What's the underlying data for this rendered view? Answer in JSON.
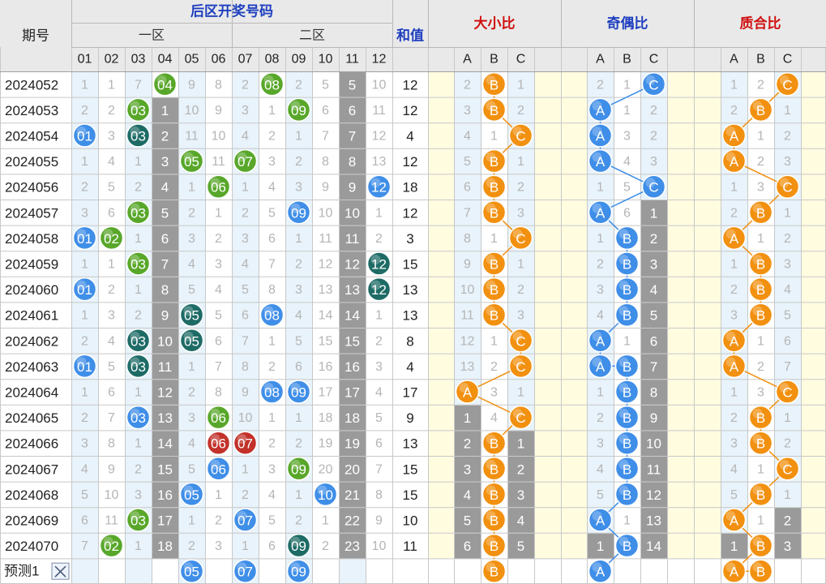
{
  "header": {
    "period_label": "期号",
    "back_zone_title": "后区开奖号码",
    "zone1_label": "一区",
    "zone2_label": "二区",
    "sum_label": "和值",
    "size_ratio_label": "大小比",
    "odd_even_label": "奇偶比",
    "prime_label": "质合比"
  },
  "num_headers": [
    "01",
    "02",
    "03",
    "04",
    "05",
    "06",
    "07",
    "08",
    "09",
    "10",
    "11",
    "12"
  ],
  "ratio_headers": [
    "A",
    "B",
    "C"
  ],
  "colors": {
    "header_bg": "#e9e9e9",
    "title_blue": "#1f3fbf",
    "title_red": "#d01010",
    "stripe_blue": "#e8f3fb",
    "stripe_white": "#ffffff",
    "yellow_bg": "#fffce0",
    "miss_gray": "#9a9a9a",
    "ball_green": "#58a72a",
    "ball_blue": "#3f8ee8",
    "ball_teal": "#1e6b66",
    "ball_red": "#c2322a",
    "ball_orange": "#f2900f",
    "line_blue": "#3f8ee8",
    "line_orange": "#f2900f"
  },
  "rows": [
    {
      "period": "2024052",
      "cells": [
        "1",
        "1",
        "7",
        "04",
        "9",
        "8",
        "2",
        "08",
        "2",
        "5",
        "5",
        "10"
      ],
      "ball": [
        "",
        "",
        "",
        "green",
        "",
        "",
        "",
        "green",
        "",
        "",
        "",
        ""
      ],
      "sum": "12",
      "size": [
        "2",
        "B",
        "1"
      ],
      "parity": [
        "2",
        "1",
        "C"
      ],
      "prime": [
        "1",
        "2",
        "C"
      ]
    },
    {
      "period": "2024053",
      "cells": [
        "2",
        "2",
        "03",
        "1",
        "10",
        "9",
        "3",
        "1",
        "09",
        "6",
        "6",
        "11"
      ],
      "ball": [
        "",
        "",
        "green",
        "",
        "",
        "",
        "",
        "",
        "green",
        "",
        "",
        ""
      ],
      "sum": "12",
      "size": [
        "3",
        "B",
        "2"
      ],
      "parity": [
        "A",
        "1",
        "2"
      ],
      "prime": [
        "2",
        "B",
        "1"
      ]
    },
    {
      "period": "2024054",
      "cells": [
        "01",
        "3",
        "03",
        "2",
        "11",
        "10",
        "4",
        "2",
        "1",
        "7",
        "7",
        "12"
      ],
      "ball": [
        "blue",
        "",
        "teal",
        "",
        "",
        "",
        "",
        "",
        "",
        "",
        "",
        ""
      ],
      "sum": "4",
      "size": [
        "4",
        "1",
        "C"
      ],
      "parity": [
        "A",
        "3",
        "2"
      ],
      "prime": [
        "A",
        "1",
        "2"
      ]
    },
    {
      "period": "2024055",
      "cells": [
        "1",
        "4",
        "1",
        "3",
        "05",
        "11",
        "07",
        "3",
        "2",
        "8",
        "8",
        "13"
      ],
      "ball": [
        "",
        "",
        "",
        "",
        "green",
        "",
        "green",
        "",
        "",
        "",
        "",
        ""
      ],
      "sum": "12",
      "size": [
        "5",
        "B",
        "1"
      ],
      "parity": [
        "A",
        "4",
        "3"
      ],
      "prime": [
        "A",
        "2",
        "3"
      ]
    },
    {
      "period": "2024056",
      "cells": [
        "2",
        "5",
        "2",
        "4",
        "1",
        "06",
        "1",
        "4",
        "3",
        "9",
        "9",
        "12"
      ],
      "ball": [
        "",
        "",
        "",
        "",
        "",
        "green",
        "",
        "",
        "",
        "",
        "",
        "blue"
      ],
      "sum": "18",
      "size": [
        "6",
        "B",
        "2"
      ],
      "parity": [
        "1",
        "5",
        "C"
      ],
      "prime": [
        "1",
        "3",
        "C"
      ]
    },
    {
      "period": "2024057",
      "cells": [
        "3",
        "6",
        "03",
        "5",
        "2",
        "1",
        "2",
        "5",
        "09",
        "10",
        "10",
        "1"
      ],
      "ball": [
        "",
        "",
        "green",
        "",
        "",
        "",
        "",
        "",
        "blue",
        "",
        "",
        ""
      ],
      "sum": "12",
      "size": [
        "7",
        "B",
        "3"
      ],
      "parity": [
        "A",
        "6",
        "1"
      ],
      "prime": [
        "2",
        "B",
        "1"
      ]
    },
    {
      "period": "2024058",
      "cells": [
        "01",
        "02",
        "1",
        "6",
        "3",
        "2",
        "3",
        "6",
        "1",
        "11",
        "11",
        "2"
      ],
      "ball": [
        "blue",
        "green",
        "",
        "",
        "",
        "",
        "",
        "",
        "",
        "",
        "",
        ""
      ],
      "sum": "3",
      "size": [
        "8",
        "1",
        "C"
      ],
      "parity": [
        "1",
        "B",
        "2"
      ],
      "prime": [
        "A",
        "1",
        "2"
      ]
    },
    {
      "period": "2024059",
      "cells": [
        "1",
        "1",
        "03",
        "7",
        "4",
        "3",
        "4",
        "7",
        "2",
        "12",
        "12",
        "12"
      ],
      "ball": [
        "",
        "",
        "green",
        "",
        "",
        "",
        "",
        "",
        "",
        "",
        "",
        "teal"
      ],
      "sum": "15",
      "size": [
        "9",
        "B",
        "1"
      ],
      "parity": [
        "2",
        "B",
        "3"
      ],
      "prime": [
        "1",
        "B",
        "3"
      ]
    },
    {
      "period": "2024060",
      "cells": [
        "01",
        "2",
        "1",
        "8",
        "5",
        "4",
        "5",
        "8",
        "3",
        "13",
        "13",
        "12"
      ],
      "ball": [
        "blue",
        "",
        "",
        "",
        "",
        "",
        "",
        "",
        "",
        "",
        "",
        "teal"
      ],
      "sum": "13",
      "size": [
        "10",
        "B",
        "2"
      ],
      "parity": [
        "3",
        "B",
        "4"
      ],
      "prime": [
        "2",
        "B",
        "4"
      ]
    },
    {
      "period": "2024061",
      "cells": [
        "1",
        "3",
        "2",
        "9",
        "05",
        "5",
        "6",
        "08",
        "4",
        "14",
        "14",
        "1"
      ],
      "ball": [
        "",
        "",
        "",
        "",
        "teal",
        "",
        "",
        "blue",
        "",
        "",
        "",
        ""
      ],
      "sum": "13",
      "size": [
        "11",
        "B",
        "3"
      ],
      "parity": [
        "4",
        "B",
        "5"
      ],
      "prime": [
        "3",
        "B",
        "5"
      ]
    },
    {
      "period": "2024062",
      "cells": [
        "2",
        "4",
        "03",
        "10",
        "05",
        "6",
        "7",
        "1",
        "5",
        "15",
        "15",
        "2"
      ],
      "ball": [
        "",
        "",
        "teal",
        "",
        "teal",
        "",
        "",
        "",
        "",
        "",
        "",
        ""
      ],
      "sum": "8",
      "size": [
        "12",
        "1",
        "C"
      ],
      "parity": [
        "A",
        "1",
        "6"
      ],
      "prime": [
        "A",
        "1",
        "6"
      ]
    },
    {
      "period": "2024063",
      "cells": [
        "01",
        "5",
        "03",
        "11",
        "1",
        "7",
        "8",
        "2",
        "6",
        "16",
        "16",
        "3"
      ],
      "ball": [
        "blue",
        "",
        "teal",
        "",
        "",
        "",
        "",
        "",
        "",
        "",
        "",
        ""
      ],
      "sum": "4",
      "size": [
        "13",
        "2",
        "C"
      ],
      "parity": [
        "A",
        "B",
        "7"
      ],
      "prime": [
        "A",
        "2",
        "7"
      ]
    },
    {
      "period": "2024064",
      "cells": [
        "1",
        "6",
        "1",
        "12",
        "2",
        "8",
        "9",
        "08",
        "09",
        "17",
        "17",
        "4"
      ],
      "ball": [
        "",
        "",
        "",
        "",
        "",
        "",
        "",
        "blue",
        "blue",
        "",
        "",
        ""
      ],
      "sum": "17",
      "size": [
        "A",
        "3",
        "1"
      ],
      "parity": [
        "1",
        "B",
        "8"
      ],
      "prime": [
        "1",
        "3",
        "C"
      ]
    },
    {
      "period": "2024065",
      "cells": [
        "2",
        "7",
        "03",
        "13",
        "3",
        "06",
        "10",
        "1",
        "1",
        "18",
        "18",
        "5"
      ],
      "ball": [
        "",
        "",
        "blue",
        "",
        "",
        "green",
        "",
        "",
        "",
        "",
        "",
        ""
      ],
      "sum": "9",
      "size": [
        "1",
        "4",
        "C"
      ],
      "parity": [
        "2",
        "B",
        "9"
      ],
      "prime": [
        "2",
        "B",
        "1"
      ]
    },
    {
      "period": "2024066",
      "cells": [
        "3",
        "8",
        "1",
        "14",
        "4",
        "06",
        "07",
        "2",
        "2",
        "19",
        "19",
        "6"
      ],
      "ball": [
        "",
        "",
        "",
        "",
        "",
        "red",
        "red",
        "",
        "",
        "",
        "",
        ""
      ],
      "sum": "13",
      "size": [
        "2",
        "B",
        "1"
      ],
      "parity": [
        "3",
        "B",
        "10"
      ],
      "prime": [
        "3",
        "B",
        "2"
      ]
    },
    {
      "period": "2024067",
      "cells": [
        "4",
        "9",
        "2",
        "15",
        "5",
        "06",
        "1",
        "3",
        "09",
        "20",
        "20",
        "7"
      ],
      "ball": [
        "",
        "",
        "",
        "",
        "",
        "blue",
        "",
        "",
        "green",
        "",
        "",
        ""
      ],
      "sum": "15",
      "size": [
        "3",
        "B",
        "2"
      ],
      "parity": [
        "4",
        "B",
        "11"
      ],
      "prime": [
        "4",
        "1",
        "C"
      ]
    },
    {
      "period": "2024068",
      "cells": [
        "5",
        "10",
        "3",
        "16",
        "05",
        "1",
        "2",
        "4",
        "1",
        "10",
        "21",
        "8"
      ],
      "ball": [
        "",
        "",
        "",
        "",
        "blue",
        "",
        "",
        "",
        "",
        "blue",
        "",
        ""
      ],
      "sum": "15",
      "size": [
        "4",
        "B",
        "3"
      ],
      "parity": [
        "5",
        "B",
        "12"
      ],
      "prime": [
        "5",
        "B",
        "1"
      ]
    },
    {
      "period": "2024069",
      "cells": [
        "6",
        "11",
        "03",
        "17",
        "1",
        "2",
        "07",
        "5",
        "2",
        "1",
        "22",
        "9"
      ],
      "ball": [
        "",
        "",
        "green",
        "",
        "",
        "",
        "blue",
        "",
        "",
        "",
        "",
        ""
      ],
      "sum": "10",
      "size": [
        "5",
        "B",
        "4"
      ],
      "parity": [
        "A",
        "1",
        "13"
      ],
      "prime": [
        "A",
        "1",
        "2"
      ]
    },
    {
      "period": "2024070",
      "cells": [
        "7",
        "02",
        "1",
        "18",
        "2",
        "3",
        "1",
        "6",
        "09",
        "2",
        "23",
        "10"
      ],
      "ball": [
        "",
        "green",
        "",
        "",
        "",
        "",
        "",
        "",
        "teal",
        "",
        "",
        ""
      ],
      "sum": "11",
      "size": [
        "6",
        "B",
        "5"
      ],
      "parity": [
        "1",
        "B",
        "14"
      ],
      "prime": [
        "1",
        "B",
        "3"
      ]
    }
  ],
  "predict": {
    "label": "预测1",
    "close_icon": "close-icon",
    "balls": [
      {
        "col": 5,
        "text": "05"
      },
      {
        "col": 7,
        "text": "07"
      },
      {
        "col": 9,
        "text": "09"
      }
    ],
    "size": [
      "",
      "B",
      ""
    ],
    "parity": [
      "A",
      "",
      ""
    ],
    "prime": [
      "A",
      "B",
      ""
    ]
  }
}
